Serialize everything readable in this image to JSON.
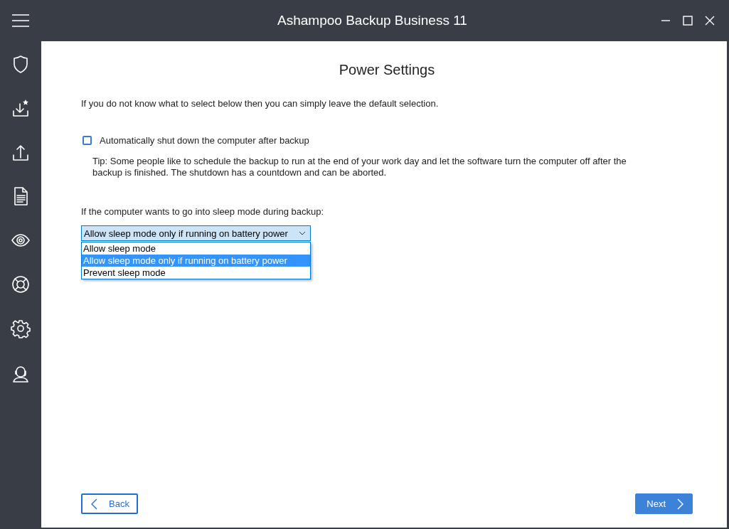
{
  "window": {
    "title": "Ashampoo Backup Business 11"
  },
  "page": {
    "title": "Power Settings",
    "intro": "If you do not know what to select below then you can simply leave the default selection.",
    "shutdown": {
      "label": "Automatically shut down the computer after backup",
      "checked": false
    },
    "tip": "Tip: Some people like to schedule the backup to run at the end of your work day and let the software turn the computer off after the backup is finished. The shutdown has a countdown and can be aborted.",
    "sleep_label": "If the computer wants to go into sleep mode during backup:",
    "sleep_select": {
      "value": "Allow sleep mode only if running on battery power",
      "expanded": true,
      "options": [
        {
          "label": "Allow sleep mode",
          "selected": false
        },
        {
          "label": "Allow sleep mode only if running on battery power",
          "selected": true
        },
        {
          "label": "Prevent sleep mode",
          "selected": false
        }
      ]
    }
  },
  "buttons": [
    {
      "kind": "back",
      "label": "Back"
    },
    {
      "kind": "next",
      "label": "Next"
    }
  ]
}
